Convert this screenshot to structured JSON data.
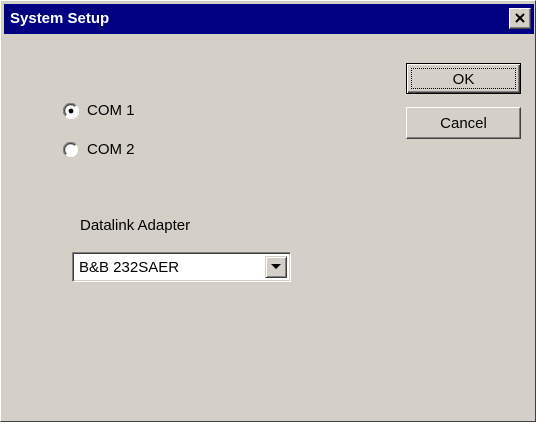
{
  "window": {
    "title": "System Setup",
    "close_icon": "close-icon"
  },
  "buttons": {
    "ok_label": "OK",
    "cancel_label": "Cancel"
  },
  "port_options": [
    {
      "label": "COM 1",
      "selected": true
    },
    {
      "label": "COM 2",
      "selected": false
    }
  ],
  "datalink": {
    "label": "Datalink Adapter",
    "selected_value": "B&B 232SAER",
    "dropdown_icon": "chevron-down-icon"
  },
  "colors": {
    "titlebar": "#000080",
    "face": "#d4d0c8"
  }
}
